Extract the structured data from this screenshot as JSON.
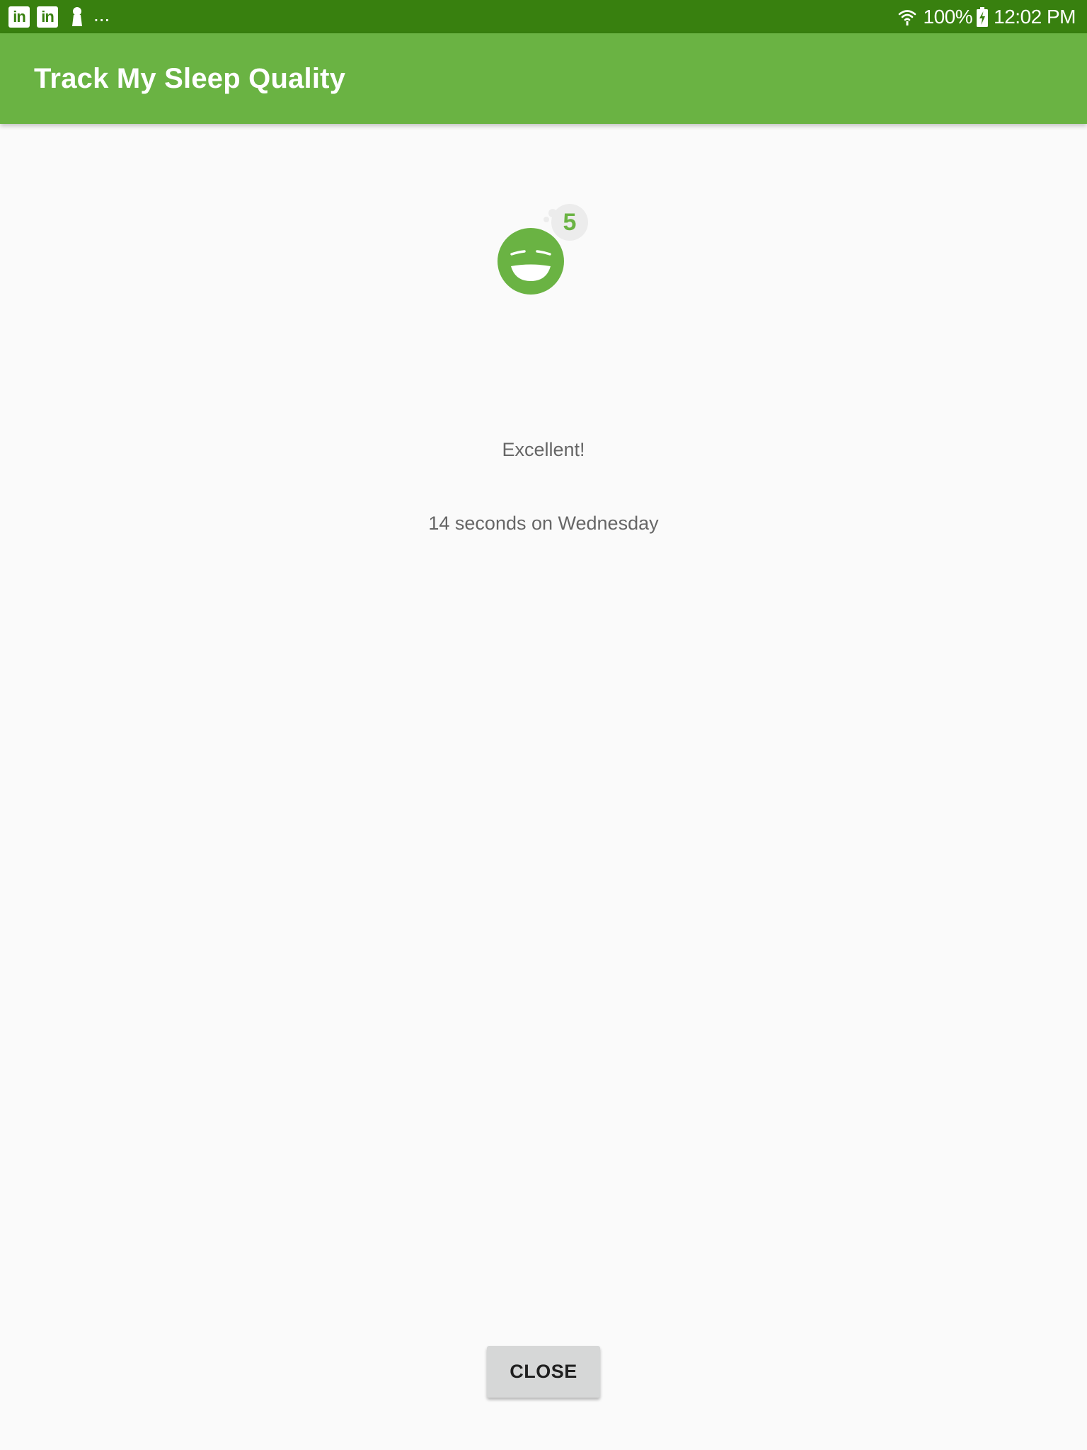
{
  "status_bar": {
    "notification_icons": [
      "linkedin-icon",
      "linkedin-icon",
      "keyhole-icon"
    ],
    "linkedin_glyph": "in",
    "more": "...",
    "battery": "100%",
    "time": "12:02 PM"
  },
  "app_bar": {
    "title": "Track My Sleep Quality"
  },
  "detail": {
    "quality_score": "5",
    "quality_label": "Excellent!",
    "duration": "14 seconds on Wednesday",
    "close_label": "CLOSE"
  },
  "colors": {
    "status_bar": "#38800f",
    "app_bar": "#6ab343",
    "accent_green": "#6ab343",
    "background": "#fafafa",
    "secondary_text": "#666666",
    "button": "#d6d7d7"
  }
}
